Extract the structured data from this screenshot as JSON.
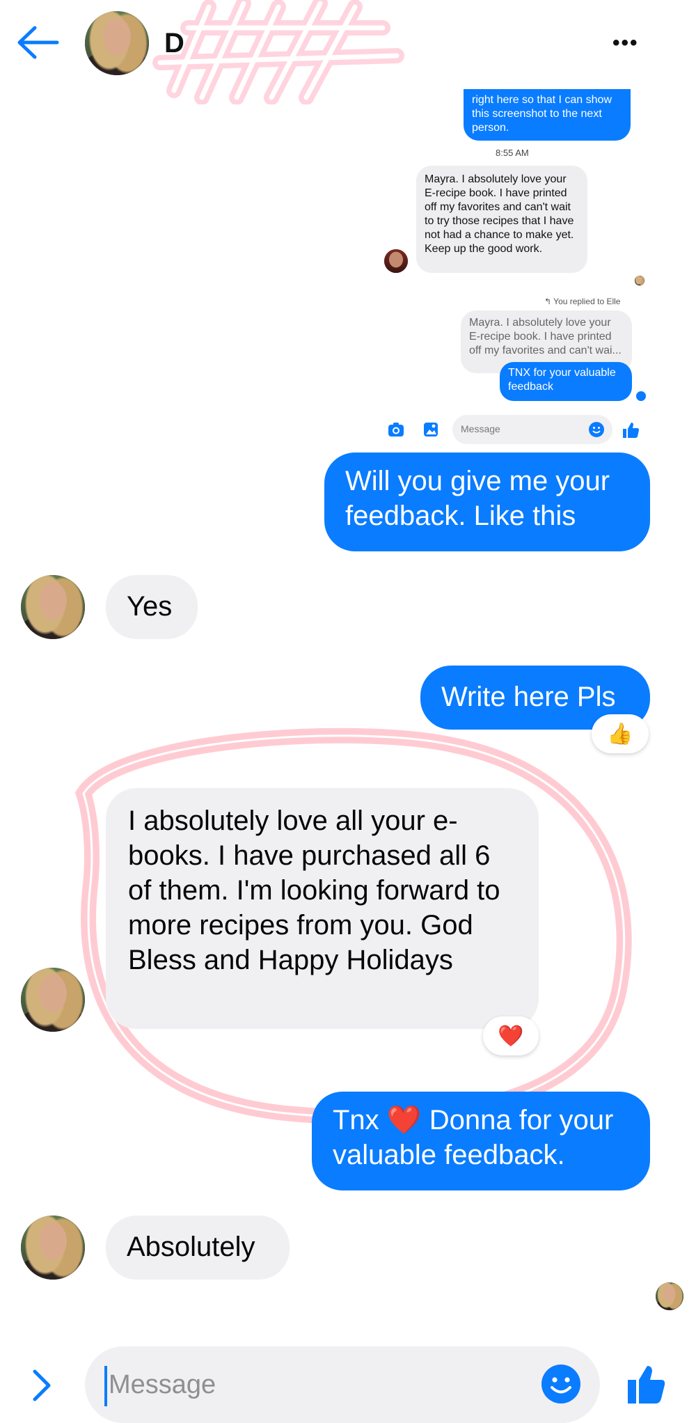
{
  "header": {
    "name": "D",
    "back_icon": "arrow-left-icon",
    "more_icon": "more-horizontal-icon",
    "more_label": "•••"
  },
  "screenshot": {
    "top_message": "right here so that I can show this screenshot to the next person.",
    "timestamp": "8:55 AM",
    "review_message": "Mayra. I absolutely love your E-recipe book.  I have printed off my favorites and can't wait to try those recipes that I have not had a chance to make yet. Keep up the good work.",
    "replied_label": "You replied to Elle",
    "quoted_message": "Mayra. I absolutely love your E-recipe book.  I have printed off my favorites and can't wai...",
    "reply_message": "TNX for your valuable feedback",
    "composer_placeholder": "Message"
  },
  "messages": [
    {
      "from": "me",
      "text": "Will you give me your feedback. Like this"
    },
    {
      "from": "them",
      "text": "Yes"
    },
    {
      "from": "me",
      "text": "Write here Pls",
      "reaction": "👍"
    },
    {
      "from": "them",
      "text": "I absolutely love all your e-books. I have purchased all 6 of them. I'm looking forward to more recipes from you. God Bless and Happy Holidays",
      "reaction": "❤️"
    },
    {
      "from": "me",
      "text_before": "Tnx ",
      "emoji": "❤️",
      "text_after": " Donna for your valuable feedback."
    },
    {
      "from": "them",
      "text": "Absolutely"
    }
  ],
  "composer": {
    "placeholder": "Message"
  },
  "colors": {
    "accent": "#0a7cff",
    "bubble_gray": "#f0f0f2",
    "highlight": "#ff5a6e"
  }
}
